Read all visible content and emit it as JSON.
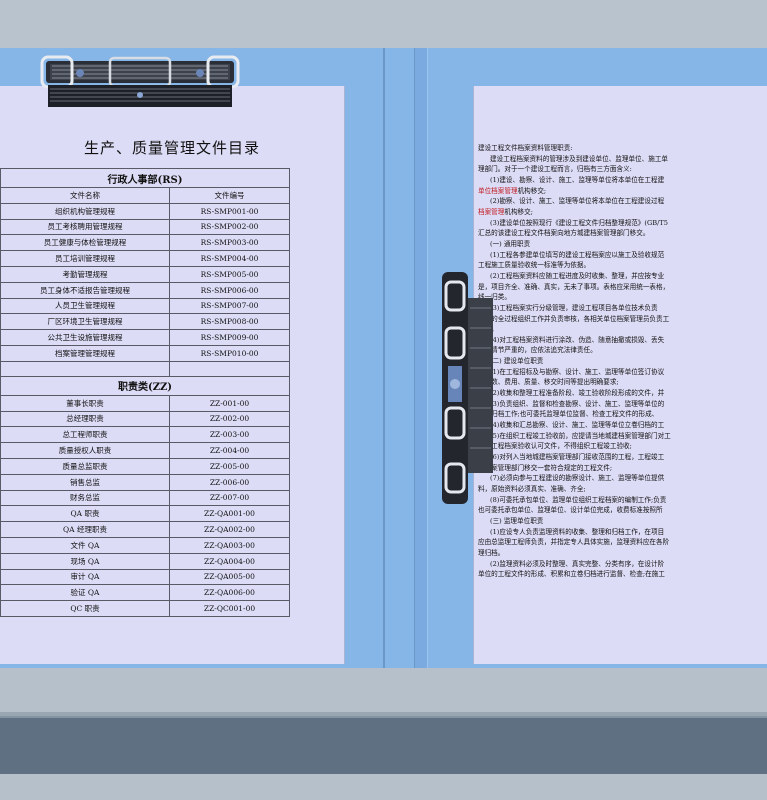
{
  "doc": {
    "title": "生产、质量管理文件目录",
    "sections": [
      {
        "name": "行政人事部(RS)",
        "headers": [
          "文件名称",
          "文件编号"
        ],
        "rows": [
          [
            "组织机构管理规程",
            "RS-SMP001-00"
          ],
          [
            "员工考核聘用管理规程",
            "RS-SMP002-00"
          ],
          [
            "员工健康与体检管理规程",
            "RS-SMP003-00"
          ],
          [
            "员工培训管理规程",
            "RS-SMP004-00"
          ],
          [
            "考勤管理规程",
            "RS-SMP005-00"
          ],
          [
            "员工身体不适报告管理规程",
            "RS-SMP006-00"
          ],
          [
            "人员卫生管理规程",
            "RS-SMP007-00"
          ],
          [
            "厂区环境卫生管理规程",
            "RS-SMP008-00"
          ],
          [
            "公共卫生设施管理规程",
            "RS-SMP009-00"
          ],
          [
            "档案管理管理规程",
            "RS-SMP010-00"
          ]
        ]
      },
      {
        "name": "职责类(ZZ)",
        "rows": [
          [
            "董事长职责",
            "ZZ-001-00"
          ],
          [
            "总经理职责",
            "ZZ-002-00"
          ],
          [
            "总工程师职责",
            "ZZ-003-00"
          ],
          [
            "质量授权人职责",
            "ZZ-004-00"
          ],
          [
            "质量总监职责",
            "ZZ-005-00"
          ],
          [
            "销售总监",
            "ZZ-006-00"
          ],
          [
            "财务总监",
            "ZZ-007-00"
          ],
          [
            "QA 职责",
            "ZZ-QA001-00"
          ],
          [
            "QA 经理职责",
            "ZZ-QA002-00"
          ],
          [
            "文件 QA",
            "ZZ-QA003-00"
          ],
          [
            "现场 QA",
            "ZZ-QA004-00"
          ],
          [
            "审计 QA",
            "ZZ-QA005-00"
          ],
          [
            "验证 QA",
            "ZZ-QA006-00"
          ],
          [
            "QC 职责",
            "ZZ-QC001-00"
          ]
        ]
      }
    ]
  },
  "right_page": {
    "lines": [
      {
        "segments": [
          {
            "text": "建设工程文件档案资料管理职责:"
          }
        ]
      },
      {
        "segments": [
          {
            "text": "建设工程档案资料的管理涉及到建设单位、监理单位、施工单"
          }
        ]
      },
      {
        "segments": [
          {
            "text": "理部门。对于一个建设工程而言，归档有三方面含义:"
          }
        ]
      },
      {
        "segments": [
          {
            "text": "(1)建设、勘察、设计、施工、监理等单位将本单位在工程建"
          }
        ]
      },
      {
        "segments": [
          {
            "text": "单位档案管理",
            "red": true
          },
          {
            "text": "机构移交;"
          }
        ]
      },
      {
        "segments": [
          {
            "text": "(2)勘察、设计、施工、监理等单位将本单位在工程建设过程"
          }
        ]
      },
      {
        "segments": [
          {
            "text": "档案管理",
            "red": true
          },
          {
            "text": "机构移交;"
          }
        ]
      },
      {
        "segments": [
          {
            "text": "(3)建设单位按照现行《建设工程文件归档整理规范》(GB/T5"
          }
        ]
      },
      {
        "segments": [
          {
            "text": "汇总的该建设工程文件档案向地方城建档案管理部门移交。"
          }
        ]
      },
      {
        "segments": [
          {
            "text": "(一) 通用职责"
          }
        ]
      },
      {
        "segments": [
          {
            "text": "(1)工程各参建单位填写的建设工程档案应以施工及验收规范"
          }
        ]
      },
      {
        "segments": [
          {
            "text": "工程施工质量验收统一标准等为依据。"
          }
        ]
      },
      {
        "segments": [
          {
            "text": "(2)工程档案资料应随工程进度及时收集、整理，并应按专业"
          }
        ]
      },
      {
        "segments": [
          {
            "text": "是，项目齐全、准确、真实，无未了事项。表格应采用统一表格，"
          }
        ]
      },
      {
        "segments": [
          {
            "text": "线一归类。"
          }
        ]
      },
      {
        "segments": [
          {
            "text": "(3)工程档案实行分级管理，建设工程项目各单位技术负责"
          }
        ]
      },
      {
        "segments": [
          {
            "text": "资料的全过程组织工作并负责审核，各相关单位档案管理员负责工"
          }
        ]
      },
      {
        "segments": [
          {
            "text": "工作。"
          }
        ]
      },
      {
        "segments": [
          {
            "text": "(4)对工程档案资料进行涂改、伪造、随意抽撤或损毁、丢失"
          }
        ]
      },
      {
        "segments": [
          {
            "text": "罚，情节严重的，应依法追究法律责任。"
          }
        ]
      },
      {
        "segments": [
          {
            "text": "(二) 建设单位职责"
          }
        ]
      },
      {
        "segments": [
          {
            "text": "(1)在工程招标及与勘察、设计、施工、监理等单位签订协议"
          }
        ]
      },
      {
        "segments": [
          {
            "text": "的套数、费用、质量、移交时间等提出明确要求;"
          }
        ]
      },
      {
        "segments": [
          {
            "text": "(2)收集和整理工程准备阶段、竣工验收阶段形成的文件，并"
          }
        ]
      },
      {
        "segments": [
          {
            "text": "(3)负责组织、监督和检查勘察、设计、施工、监理等单位的"
          }
        ]
      },
      {
        "segments": [
          {
            "text": "立卷归档工作;也可委托监理单位监督、检查工程文件的形成、"
          }
        ]
      },
      {
        "segments": [
          {
            "text": "(4)收集和汇总勘察、设计、施工、监理等单位立卷归档的工"
          }
        ]
      },
      {
        "segments": [
          {
            "text": "(5)在组织工程竣工验收前，应提请当地城建档案管理部门对工"
          }
        ]
      },
      {
        "segments": [
          {
            "text": "取得工程档案验收认可文件，不得组织工程竣工验收;"
          }
        ]
      },
      {
        "segments": [
          {
            "text": "(6)对列入当地城建档案管理部门接收范围的工程，工程竣工"
          }
        ]
      },
      {
        "segments": [
          {
            "text": "建档案管理部门移交一套符合规定的工程文件;"
          }
        ]
      },
      {
        "segments": [
          {
            "text": "(7)必须向参与工程建设的勘察设计、施工、监理等单位提供"
          }
        ]
      },
      {
        "segments": [
          {
            "text": "料，原始资料必须真实、准确、齐全;"
          }
        ]
      },
      {
        "segments": [
          {
            "text": "(8)可委托承包单位、监理单位组织工程档案的编制工作;负责"
          }
        ]
      },
      {
        "segments": [
          {
            "text": "也可委托承包单位、监理单位、设计单位完成，收费标准按照所"
          }
        ]
      },
      {
        "segments": [
          {
            "text": "(三) 监理单位职责"
          }
        ]
      },
      {
        "segments": [
          {
            "text": "(1)应设专人负责监理资料的收集、整理和归档工作，在项目"
          }
        ]
      },
      {
        "segments": [
          {
            "text": "应由总监理工程师负责，并指定专人具体实施，监理资料应在各阶"
          }
        ]
      },
      {
        "segments": [
          {
            "text": "理归档。"
          }
        ]
      },
      {
        "segments": [
          {
            "text": "(2)监理资料必须及时整理、真实完整、分类有序，在设计阶"
          }
        ]
      },
      {
        "segments": [
          {
            "text": "单位的工程文件的形成、积累和立卷归档进行监督、检查;在施工"
          }
        ]
      }
    ]
  }
}
